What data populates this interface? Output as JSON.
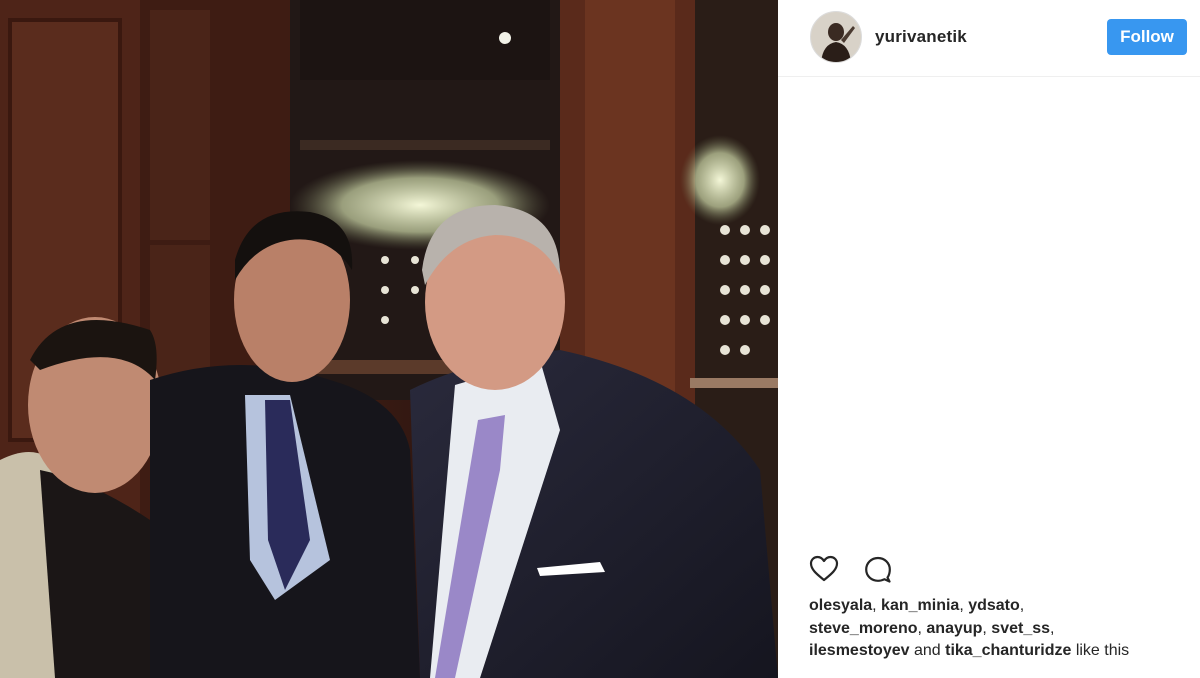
{
  "post": {
    "photo_description_icon": "photo-of-three-men",
    "header": {
      "username": "yurivanetik",
      "follow_label": "Follow"
    },
    "actions": {
      "like_icon": "heart-icon",
      "comment_icon": "comment-icon"
    },
    "likes": {
      "users": [
        "olesyala",
        "kan_minia",
        "ydsato",
        "steve_moreno",
        "anayup",
        "svet_ss",
        "ilesmestoyev"
      ],
      "last_user": "tika_chanturidze",
      "separator": ", ",
      "and_text": " and ",
      "suffix": " like this"
    }
  },
  "colors": {
    "follow_button": "#3897f0",
    "text": "#262626",
    "divider": "#efefef"
  }
}
